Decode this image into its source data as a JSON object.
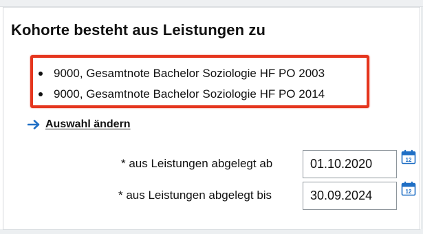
{
  "cohort": {
    "title": "Kohorte besteht aus Leistungen zu",
    "selected_items": [
      "9000, Gesamtnote Bachelor Soziologie HF PO 2003",
      "9000, Gesamtnote Bachelor Soziologie HF PO 2014"
    ],
    "change_link": {
      "label": "Auswahl ändern",
      "icon": "arrow-right-icon"
    },
    "fields": {
      "from": {
        "label": "* aus Leistungen abgelegt ab",
        "value": "01.10.2020",
        "icon": "calendar-icon"
      },
      "until": {
        "label": "* aus Leistungen abgelegt bis",
        "value": "30.09.2024",
        "icon": "calendar-icon"
      }
    },
    "calendar_icon_text": "12"
  },
  "colors": {
    "highlight_border": "#e5361e",
    "link_arrow": "#1f6fc5",
    "calendar_icon": "#1f6fc5"
  }
}
